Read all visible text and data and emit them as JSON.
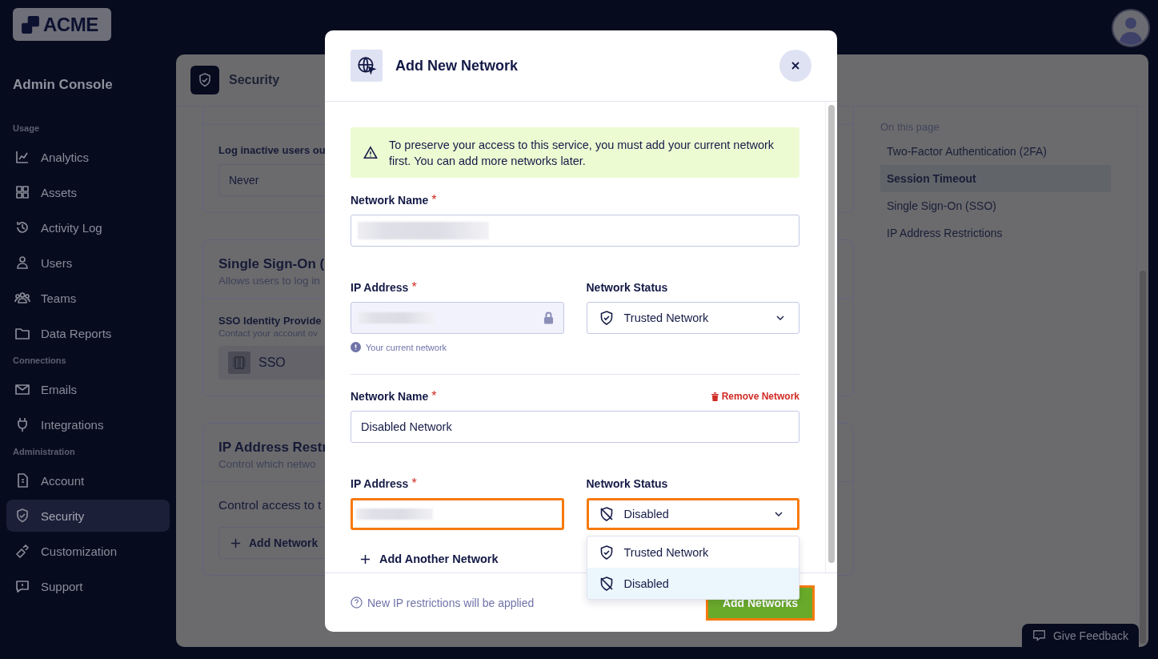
{
  "logo": {
    "text": "ACME"
  },
  "sidebar": {
    "title": "Admin Console",
    "sections": [
      {
        "heading": "Usage",
        "items": [
          {
            "label": "Analytics",
            "selected": false
          },
          {
            "label": "Assets",
            "selected": false
          },
          {
            "label": "Activity Log",
            "selected": false
          },
          {
            "label": "Users",
            "selected": false
          },
          {
            "label": "Teams",
            "selected": false
          },
          {
            "label": "Data Reports",
            "selected": false
          }
        ]
      },
      {
        "heading": "Connections",
        "items": [
          {
            "label": "Emails",
            "selected": false
          },
          {
            "label": "Integrations",
            "selected": false
          }
        ]
      },
      {
        "heading": "Administration",
        "items": [
          {
            "label": "Account",
            "selected": false
          },
          {
            "label": "Security",
            "selected": true
          },
          {
            "label": "Customization",
            "selected": false
          },
          {
            "label": "Support",
            "selected": false
          }
        ]
      }
    ]
  },
  "page": {
    "title": "Security",
    "session_card": {
      "label": "Log inactive users ou",
      "select_value": "Never"
    },
    "sso_card": {
      "title": "Single Sign-On (",
      "subtitle": "Allows users to log in",
      "field_label": "SSO Identity Provide",
      "field_hint": "Contact your account ov",
      "provider": "SSO"
    },
    "ip_card": {
      "title": "IP Address Restr",
      "subtitle": "Control which netwo",
      "description": "Control access to t",
      "button": "Add Network"
    }
  },
  "on_this_page": {
    "heading": "On this page",
    "items": [
      {
        "label": "Two-Factor Authentication (2FA)",
        "selected": false
      },
      {
        "label": "Session Timeout",
        "selected": true
      },
      {
        "label": "Single Sign-On (SSO)",
        "selected": false
      },
      {
        "label": "IP Address Restrictions",
        "selected": false
      }
    ]
  },
  "modal": {
    "title": "Add New Network",
    "alert": "To preserve your access to this service, you must add your current network first. You can add more networks later.",
    "networks": [
      {
        "name_label": "Network Name",
        "name_required_mark": "*",
        "name_redacted": true,
        "ip_label": "IP Address",
        "ip_required_mark": "*",
        "ip_redacted": true,
        "ip_locked": true,
        "ip_highlighted": false,
        "ip_hint": "Your current network",
        "status_label": "Network Status",
        "status": {
          "kind": "trusted",
          "value": "Trusted Network",
          "highlighted": false
        }
      },
      {
        "name_label": "Network Name",
        "name_required_mark": "*",
        "name_value": "Disabled Network",
        "remove_label": "Remove Network",
        "ip_label": "IP Address",
        "ip_required_mark": "*",
        "ip_redacted": true,
        "ip_locked": false,
        "ip_highlighted": true,
        "status_label": "Network Status",
        "status": {
          "kind": "disabled",
          "value": "Disabled",
          "highlighted": true,
          "options": [
            {
              "kind": "trusted",
              "label": "Trusted Network",
              "selected": false
            },
            {
              "kind": "disabled",
              "label": "Disabled",
              "selected": true
            }
          ]
        }
      }
    ],
    "add_another": "Add Another Network",
    "footer_note": "New IP restrictions will be applied",
    "submit": {
      "label": "Add Networks",
      "highlighted": true
    }
  },
  "feedback": {
    "label": "Give Feedback"
  }
}
